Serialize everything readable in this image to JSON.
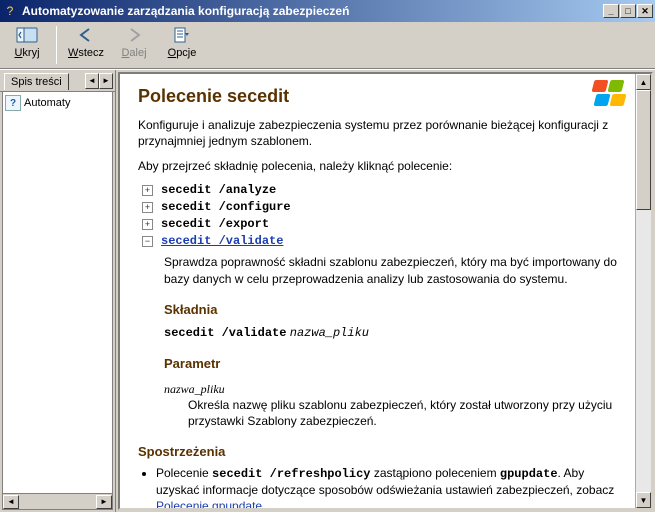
{
  "window": {
    "title": "Automatyzowanie zarządzania konfiguracją zabezpieczeń"
  },
  "toolbar": {
    "hide": {
      "label": "Ukryj",
      "accel": "U"
    },
    "back": {
      "label": "Wstecz",
      "accel": "W"
    },
    "forward": {
      "label": "Dalej",
      "accel": "D"
    },
    "options": {
      "label": "Opcje",
      "accel": "O"
    }
  },
  "tabs": {
    "toc_label": "Spis treści"
  },
  "tree": {
    "item0": "Automaty"
  },
  "content": {
    "title": "Polecenie secedit",
    "intro": "Konfiguruje i analizuje zabezpieczenia systemu przez porównanie bieżącej konfiguracji z przynajmniej jednym szablonem.",
    "instr": "Aby przejrzeć składnię polecenia, należy kliknąć polecenie:",
    "cmds": {
      "c0": "secedit /analyze",
      "c1": "secedit /configure",
      "c2": "secedit /export",
      "c3": "secedit /validate"
    },
    "validate_desc": "Sprawdza poprawność składni szablonu zabezpieczeń, który ma być importowany do bazy danych w celu przeprowadzenia analizy lub zastosowania do systemu.",
    "syntax_h": "Składnia",
    "syntax_cmd": "secedit /validate",
    "syntax_arg": "nazwa_pliku",
    "param_h": "Parametr",
    "param_name": "nazwa_pliku",
    "param_desc": "Określa nazwę pliku szablonu zabezpieczeń, który został utworzony przy użyciu przystawki Szablony zabezpieczeń.",
    "notes_h": "Spostrzeżenia",
    "note1_a": "Polecenie ",
    "note1_b": "secedit /refreshpolicy",
    "note1_c": " zastąpiono poleceniem ",
    "note1_d": "gpupdate",
    "note1_e": ". Aby uzyskać informacje dotyczące sposobów odświeżania ustawień zabezpieczeń, zobacz ",
    "note1_link": "Polecenie gpupdate",
    "note1_f": "."
  },
  "chart_data": null
}
